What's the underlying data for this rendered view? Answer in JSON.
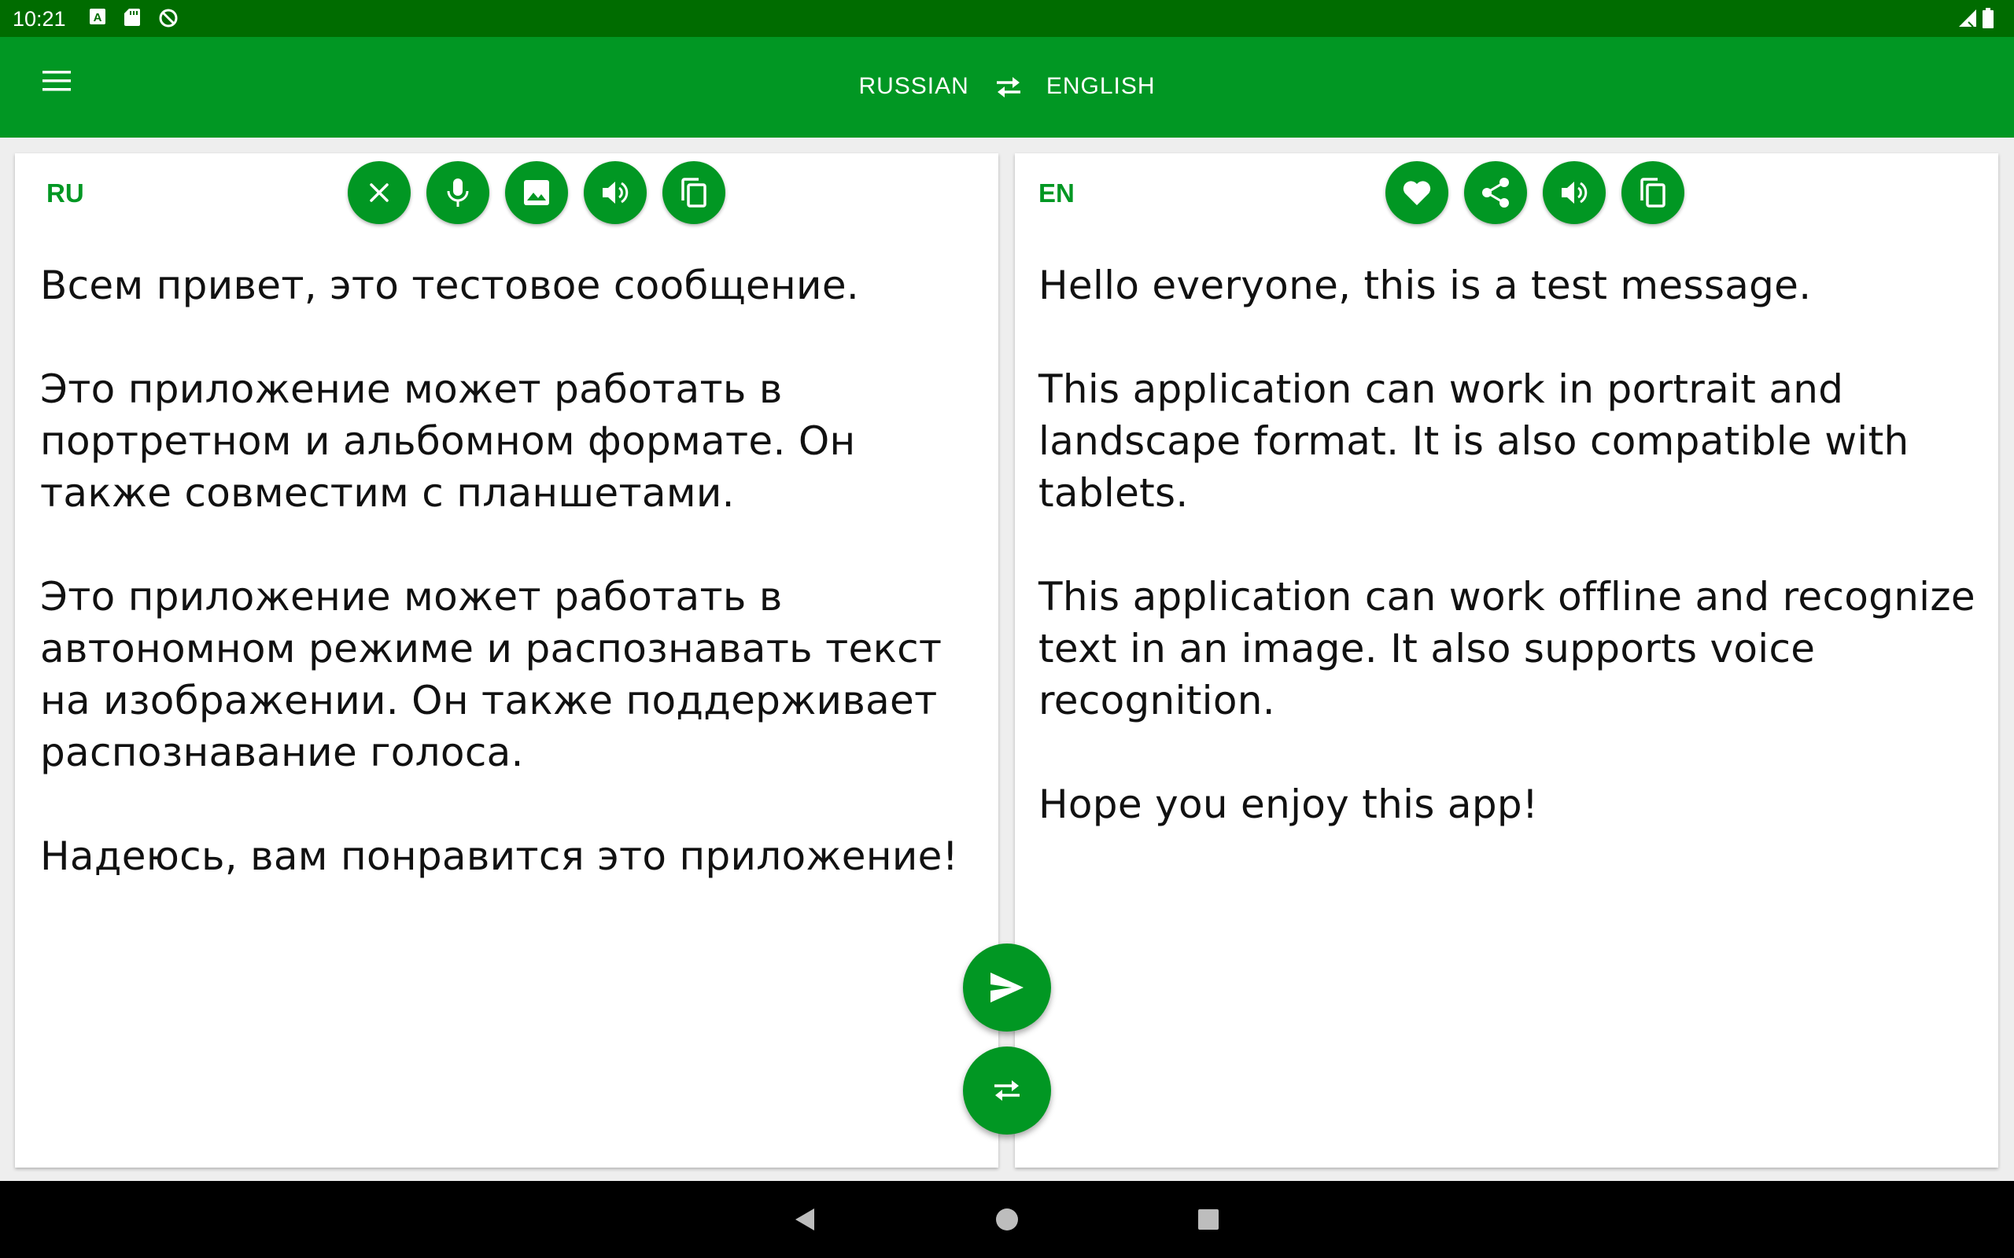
{
  "status_bar": {
    "time": "10:21",
    "left_icons": [
      "a-box-icon",
      "sd-card-icon",
      "data-saver-icon"
    ],
    "right_icons": [
      "signal-icon",
      "battery-icon"
    ]
  },
  "toolbar": {
    "menu_icon": "hamburger-menu-icon",
    "source_language": "RUSSIAN",
    "target_language": "ENGLISH",
    "swap_icon": "swap-arrows-icon"
  },
  "source_panel": {
    "lang_code": "RU",
    "actions": [
      "clear-icon",
      "mic-icon",
      "image-icon",
      "speaker-icon",
      "copy-icon"
    ],
    "text": "Всем привет, это тестовое сообщение.\n\nЭто приложение может работать в\nпортретном и альбомном формате. Он\nтакже совместим с планшетами.\n\nЭто приложение может работать в\nавтономном режиме и распознавать текст\nна изображении. Он также поддерживает\nраспознавание голоса.\n\nНадеюсь, вам понравится это приложение!"
  },
  "target_panel": {
    "lang_code": "EN",
    "actions": [
      "heart-icon",
      "share-icon",
      "speaker-icon",
      "copy-icon"
    ],
    "text": "Hello everyone, this is a test message.\n\nThis application can work in portrait and\nlandscape format. It is also compatible with\ntablets.\n\nThis application can work offline and recognize\ntext in an image. It also supports voice\nrecognition.\n\nHope you enjoy this app!"
  },
  "fabs": {
    "translate_icon": "send-icon",
    "swap_icon": "swap-arrows-icon"
  },
  "nav_bar": [
    "back-icon",
    "home-icon",
    "recents-icon"
  ],
  "colors": {
    "primary": "#019723",
    "status_bar": "#006c00",
    "background": "#eeeeee",
    "nav_bar": "#000000"
  }
}
